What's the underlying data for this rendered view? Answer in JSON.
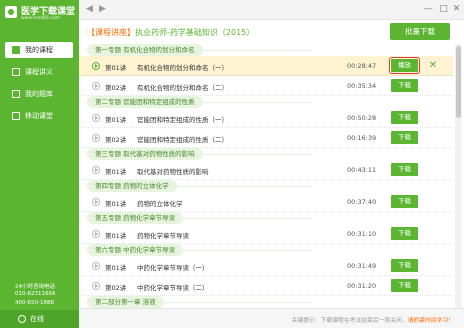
{
  "app": {
    "logo_title": "医学下载课堂",
    "logo_url": "www.med66.com"
  },
  "nav": [
    {
      "label": "我的课程",
      "icon": "book-icon"
    },
    {
      "label": "课程讲义",
      "icon": "document-icon"
    },
    {
      "label": "我的题库",
      "icon": "question-bank-icon"
    },
    {
      "label": "移动课堂",
      "icon": "mobile-icon"
    }
  ],
  "contact": {
    "hotline_label": "24小时咨询电话",
    "phone1": "010-82311666",
    "phone2": "400-650-1888"
  },
  "status": {
    "online_label": "在线"
  },
  "header": {
    "bracket": "【课程讲座】",
    "course_title": "执业药师-药学基础知识（2015）",
    "batch_download": "批量下载"
  },
  "rows": [
    {
      "kind": "topic",
      "label": "第一专题  有机化合物的划分和命名"
    },
    {
      "kind": "lesson",
      "no": "第01讲",
      "name": "有机化合物的划分和命名（一）",
      "time": "00:28:47",
      "action": "播放",
      "current": true
    },
    {
      "kind": "lesson",
      "no": "第02讲",
      "name": "有机化合物的划分和命名（二）",
      "time": "00:35:34",
      "action": "下载"
    },
    {
      "kind": "topic",
      "label": "第二专题  官能团和特定组成的性质"
    },
    {
      "kind": "lesson",
      "no": "第01讲",
      "name": "官能团和特定组成的性质（一）",
      "time": "00:50:28",
      "action": "下载"
    },
    {
      "kind": "lesson",
      "no": "第02讲",
      "name": "官能团和特定组成的性质（二）",
      "time": "00:16:39",
      "action": "下载"
    },
    {
      "kind": "topic",
      "label": "第三专题  取代基对药物性质的影响"
    },
    {
      "kind": "lesson",
      "no": "第01讲",
      "name": "取代基对药物性质的影响",
      "time": "00:43:11",
      "action": "下载"
    },
    {
      "kind": "topic",
      "label": "第四专题  药物的立体化学"
    },
    {
      "kind": "lesson",
      "no": "第01讲",
      "name": "药物的立体化学",
      "time": "00:37:40",
      "action": "下载"
    },
    {
      "kind": "topic",
      "label": "第五专题  药物化学章节导读"
    },
    {
      "kind": "lesson",
      "no": "第01讲",
      "name": "药物化学章节导读",
      "time": "00:31:10",
      "action": "下载"
    },
    {
      "kind": "topic",
      "label": "第六专题  中药化学章节导读"
    },
    {
      "kind": "lesson",
      "no": "第01讲",
      "name": "中药化学章节导读（一）",
      "time": "00:31:49",
      "action": "下载"
    },
    {
      "kind": "lesson",
      "no": "第02讲",
      "name": "中药化学章节导读（二）",
      "time": "00:31:20",
      "action": "下载"
    },
    {
      "kind": "topic",
      "label": "第二部分第一章  溶液"
    }
  ],
  "footer": {
    "tip_prefix": "关键提示：下载课程在考试结束后一周关闭，",
    "tip_link": "请抓紧时间学习！"
  },
  "colors": {
    "brand": "#5cb531",
    "accent": "#ff6a00",
    "highlight": "#fff3d1",
    "close": "#e53935"
  }
}
